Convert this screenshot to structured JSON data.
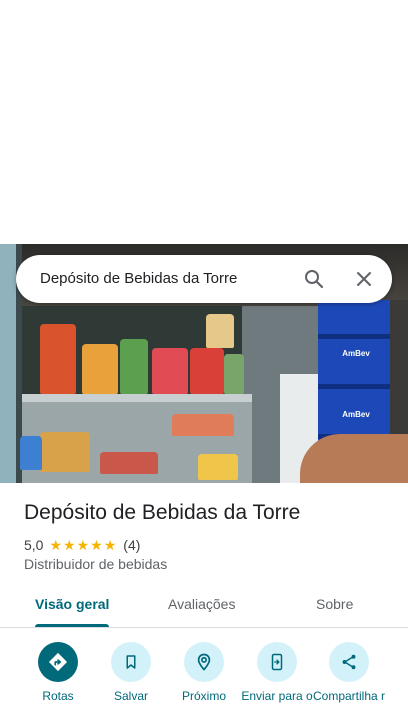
{
  "search": {
    "query": "Depósito de Bebidas da Torre"
  },
  "photo": {
    "crate_brand": "AmBev"
  },
  "place": {
    "name": "Depósito de Bebidas da Torre",
    "rating_value": "5,0",
    "rating_stars": 5,
    "review_count": "(4)",
    "category": "Distribuidor de bebidas"
  },
  "tabs": [
    {
      "label": "Visão geral",
      "active": true
    },
    {
      "label": "Avaliações",
      "active": false
    },
    {
      "label": "Sobre",
      "active": false
    }
  ],
  "actions": [
    {
      "label": "Rotas",
      "icon": "directions-icon"
    },
    {
      "label": "Salvar",
      "icon": "bookmark-icon"
    },
    {
      "label": "Próximo",
      "icon": "nearby-icon"
    },
    {
      "label": "Enviar para o",
      "icon": "send-to-phone-icon"
    },
    {
      "label": "Compartilha r",
      "icon": "share-icon"
    }
  ],
  "colors": {
    "accent": "#00697a",
    "accent_light": "#d3f1f9",
    "star": "#f5b400",
    "crate_blue": "#1d49b8"
  }
}
